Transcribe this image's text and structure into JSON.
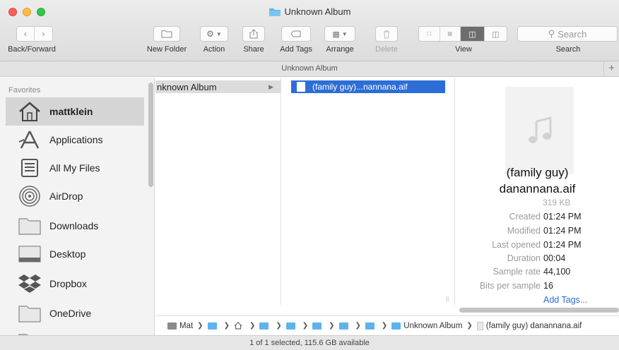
{
  "window": {
    "title": "Unknown Album"
  },
  "toolbar": {
    "back_forward_label": "Back/Forward",
    "new_folder_label": "New Folder",
    "action_label": "Action",
    "share_label": "Share",
    "add_tags_label": "Add Tags",
    "arrange_label": "Arrange",
    "delete_label": "Delete",
    "view_label": "View",
    "search_label": "Search",
    "search_placeholder": "Search"
  },
  "pathbar": {
    "title": "Unknown Album",
    "plus": "+"
  },
  "sidebar": {
    "heading": "Favorites",
    "items": [
      {
        "label": "mattklein",
        "icon": "home-icon",
        "selected": true
      },
      {
        "label": "Applications",
        "icon": "applications-icon"
      },
      {
        "label": "All My Files",
        "icon": "all-my-files-icon"
      },
      {
        "label": "AirDrop",
        "icon": "airdrop-icon"
      },
      {
        "label": "Downloads",
        "icon": "folder-icon"
      },
      {
        "label": "Desktop",
        "icon": "desktop-icon"
      },
      {
        "label": "Dropbox",
        "icon": "dropbox-icon"
      },
      {
        "label": "OneDrive",
        "icon": "folder-icon"
      }
    ]
  },
  "columns": {
    "col1_item": "nknown Album",
    "col2_item": "(family guy)...nannana.aif"
  },
  "preview": {
    "name_line1": "(family guy)",
    "name_line2": "danannana.aif",
    "size": "319 KB",
    "meta": [
      {
        "key": "Created",
        "value": "01:24 PM"
      },
      {
        "key": "Modified",
        "value": "01:24 PM"
      },
      {
        "key": "Last opened",
        "value": "01:24 PM"
      },
      {
        "key": "Duration",
        "value": "00:04"
      },
      {
        "key": "Sample rate",
        "value": "44,100"
      },
      {
        "key": "Bits per sample",
        "value": "16"
      }
    ],
    "add_tags": "Add Tags..."
  },
  "crumbs": {
    "root": "Mat",
    "album": "Unknown Album",
    "file": "(family guy) danannana.aif"
  },
  "status": {
    "text": "1 of 1 selected, 115.6 GB available"
  },
  "colors": {
    "selection": "#2c6ed6",
    "folder": "#5eb3ea",
    "link": "#2d6ed6"
  }
}
